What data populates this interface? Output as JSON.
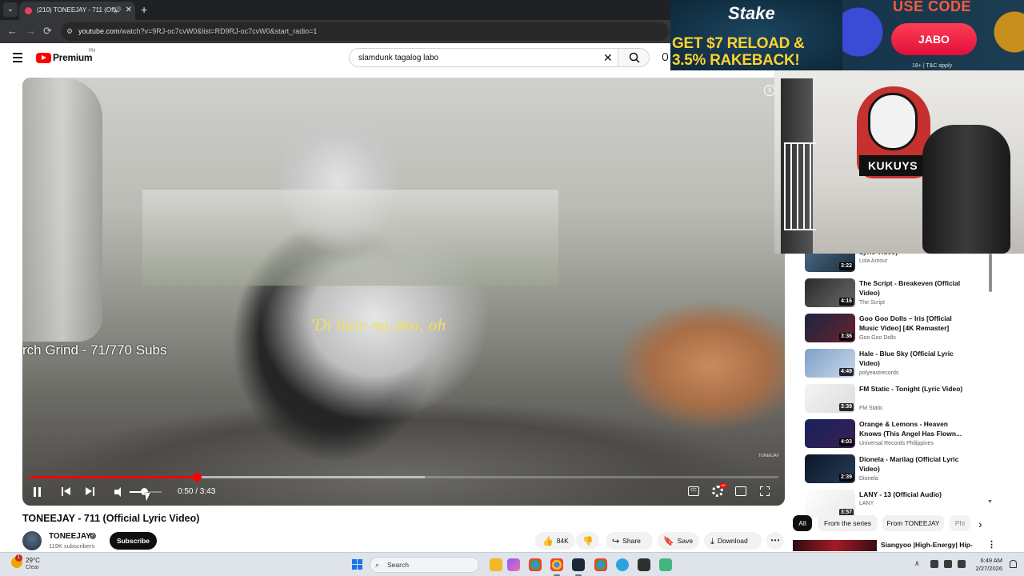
{
  "browser": {
    "tab_title": "(210) TONEEJAY - 711 (Offi",
    "url_host": "youtube.com",
    "url_path": "/watch?v=9RJ-oc7cvW0&list=RD9RJ-oc7cvW0&start_radio=1",
    "new_tab": "+",
    "back": "←",
    "forward": "→",
    "reload": "⟳",
    "tab_dropdown": "⌄",
    "close_tab": "✕"
  },
  "header": {
    "logo_text": "Premium",
    "country_code": "PH",
    "search_value": "slamdunk tagalog labo",
    "clear": "✕",
    "search_icon": "⌕"
  },
  "player": {
    "lyric": "'Di bale na ako, oh",
    "overlay_text": "rch Grind - 71/770 Subs",
    "watermark": "TONEEJAY",
    "current_time": "0:50",
    "duration": "3:43",
    "time_display": "0:50 / 3:43",
    "progress": 0.224,
    "volume": 0.45,
    "info_icon": "i",
    "quality_badge": "HD",
    "captions_label": "CC"
  },
  "video": {
    "title": "TONEEJAY - 711 (Official Lyric Video)",
    "channel": "TONEEJAY",
    "subscribers": "119K subscribers",
    "verified": "✓",
    "subscribe_label": "Subscribe",
    "likes": "84K",
    "share_label": "Share",
    "save_label": "Save",
    "download_label": "Download",
    "more": "⋯",
    "icons": {
      "like": "👍",
      "dislike": "👎",
      "share": "↪",
      "save": "🔖",
      "download": "⤓"
    }
  },
  "ad": {
    "brand": "Stake",
    "headline_1": "GET $7 RELOAD &",
    "headline_2": "3.5% RAKEBACK!",
    "use_code": "USE CODE",
    "code": "JABO",
    "terms": "18+ | T&C apply"
  },
  "webcam": {
    "sticker_label": "KUKUYS"
  },
  "sidebar": {
    "items": [
      {
        "title": "Lyric Video)",
        "channel": "Lola Amour",
        "duration": "3:22",
        "color_a": "#4d6f8a",
        "color_b": "#1b2b3a"
      },
      {
        "title": "The Script - Breakeven (Official Video)",
        "channel": "The Script",
        "duration": "4:16",
        "color_a": "#2a2a2a",
        "color_b": "#6a6a6a"
      },
      {
        "title": "Goo Goo Dolls – Iris [Official Music Video] [4K Remaster]",
        "channel": "Goo Goo Dolls",
        "duration": "3:36",
        "color_a": "#1b2440",
        "color_b": "#6a2230"
      },
      {
        "title": "Hale - Blue Sky (Official Lyric Video)",
        "channel": "polyeastrecords",
        "duration": "4:49",
        "color_a": "#7fa0c8",
        "color_b": "#c9d7ea"
      },
      {
        "title": "FM Static - Tonight (Lyric Video)",
        "channel": "FM Static",
        "duration": "3:39",
        "color_a": "#f4f4f4",
        "color_b": "#dcdcdc"
      },
      {
        "title": "Orange & Lemons - Heaven Knows (This Angel Has Flown...",
        "channel": "Universal Records Philippines",
        "duration": "4:03",
        "color_a": "#16225a",
        "color_b": "#3a1f55"
      },
      {
        "title": "Dionela - Marilag (Official Lyric Video)",
        "channel": "Dionela",
        "duration": "2:39",
        "color_a": "#0b1525",
        "color_b": "#273d5a"
      },
      {
        "title": "LANY - 13 (Official Audio)",
        "channel": "LANY",
        "duration": "3:57",
        "color_a": "#ffffff",
        "color_b": "#e8e8e8"
      }
    ],
    "chips": [
      "All",
      "From the series",
      "From TONEEJAY",
      "Phi"
    ],
    "chip_next": "›",
    "bottom_title": "Siangyoo |High-Energy| Hip-",
    "bottom_more": "⋮"
  },
  "taskbar": {
    "temperature": "29°C",
    "condition": "Clear",
    "weather_badge": "1",
    "search_label": "Search",
    "search_icon": "⌕",
    "time": "6:49 AM",
    "date": "2/27/2026",
    "tray_up": "∧"
  }
}
